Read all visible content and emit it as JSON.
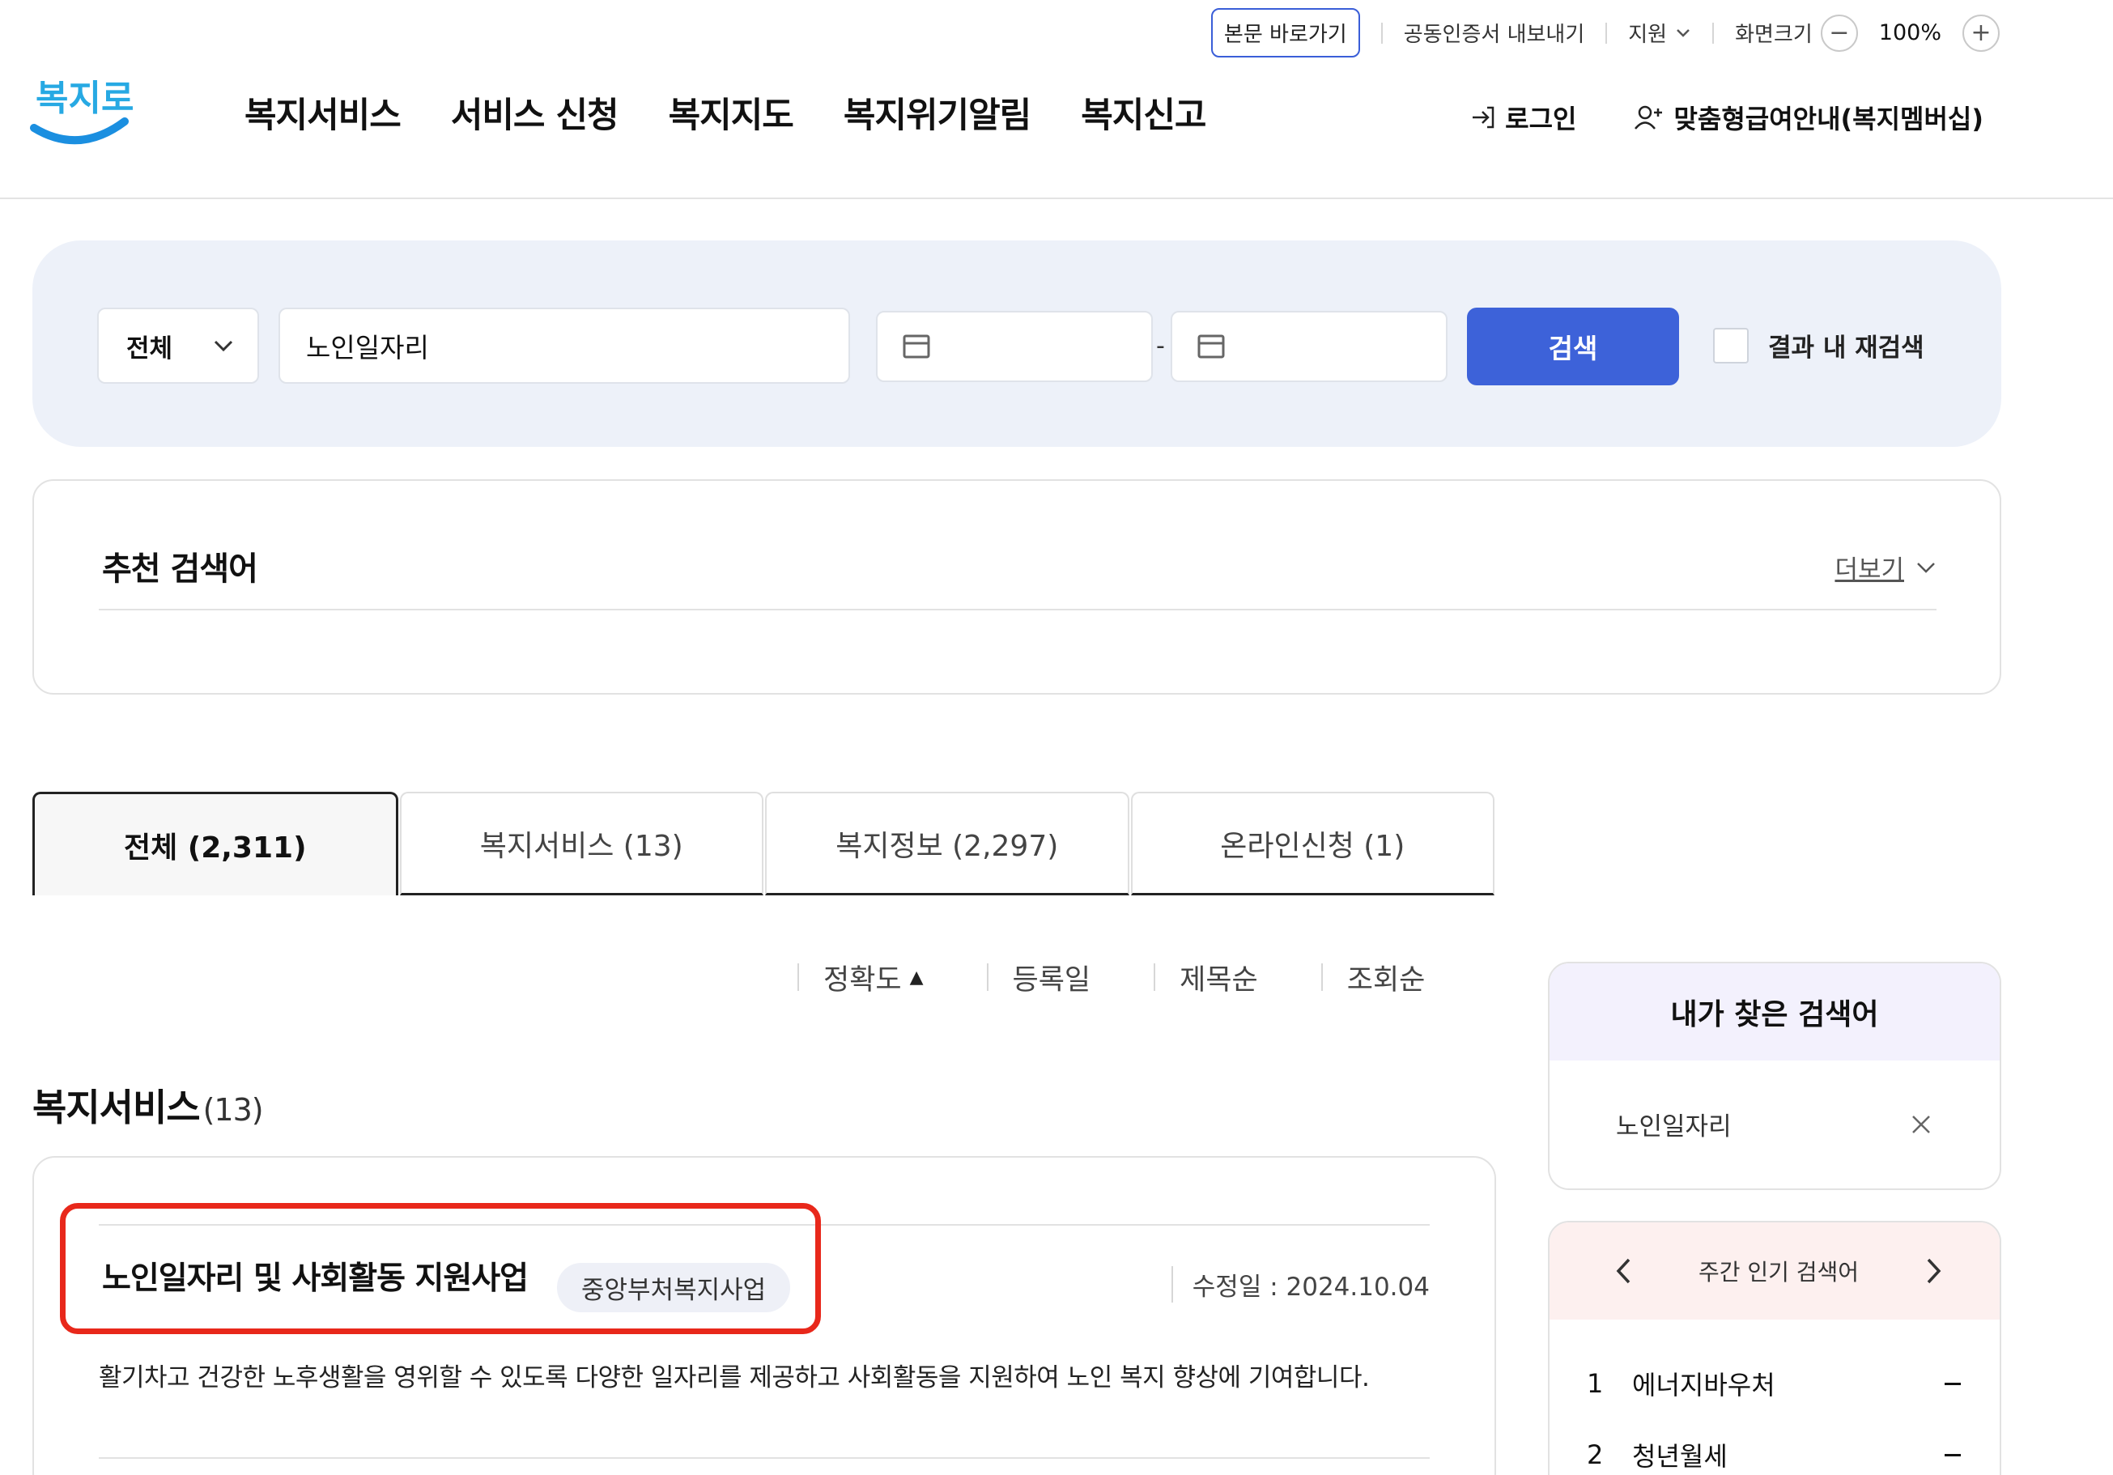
{
  "utility": {
    "skip": "본문 바로가기",
    "cert": "공동인증서 내보내기",
    "support": "지원",
    "zoom_label": "화면크기",
    "zoom_minus": "−",
    "zoom_value": "100%",
    "zoom_plus": "+"
  },
  "header": {
    "logo_text": "복지로",
    "nav": [
      "복지서비스",
      "서비스 신청",
      "복지지도",
      "복지위기알림",
      "복지신고"
    ],
    "login": "로그인",
    "membership": "맞춤형급여안내(복지멤버십)"
  },
  "search": {
    "category": "전체",
    "keyword": "노인일자리",
    "date_separator": "-",
    "button": "검색",
    "recheck": "결과 내 재검색"
  },
  "recommend": {
    "title": "추천 검색어",
    "more": "더보기"
  },
  "tabs": [
    {
      "label": "전체  (2,311)"
    },
    {
      "label": "복지서비스 (13)"
    },
    {
      "label": "복지정보 (2,297)"
    },
    {
      "label": "온라인신청 (1)"
    }
  ],
  "sort": {
    "accuracy": "정확도",
    "accuracy_marker": "▲",
    "registered": "등록일",
    "title": "제목순",
    "views": "조회순"
  },
  "section": {
    "title": "복지서비스",
    "count": "(13)"
  },
  "result": {
    "title": "노인일자리 및 사회활동 지원사업",
    "badge": "중앙부처복지사업",
    "modified": "수정일 : 2024.10.04",
    "description": "활기차고 건강한 노후생활을 영위할 수 있도록 다양한 일자리를 제공하고 사회활동을 지원하여 노인 복지 향상에 기여합니다."
  },
  "my_search": {
    "title": "내가 찾은 검색어",
    "items": [
      "노인일자리"
    ]
  },
  "popular": {
    "title": "주간 인기 검색어",
    "items": [
      {
        "rank": "1",
        "keyword": "에너지바우처"
      },
      {
        "rank": "2",
        "keyword": "청년월세"
      }
    ]
  },
  "colors": {
    "primary": "#3d62d9",
    "highlight": "#e8281b",
    "search_bg": "#edf1f9",
    "my_search_header": "#f3f1fd",
    "popular_header": "#fdf0ef"
  }
}
